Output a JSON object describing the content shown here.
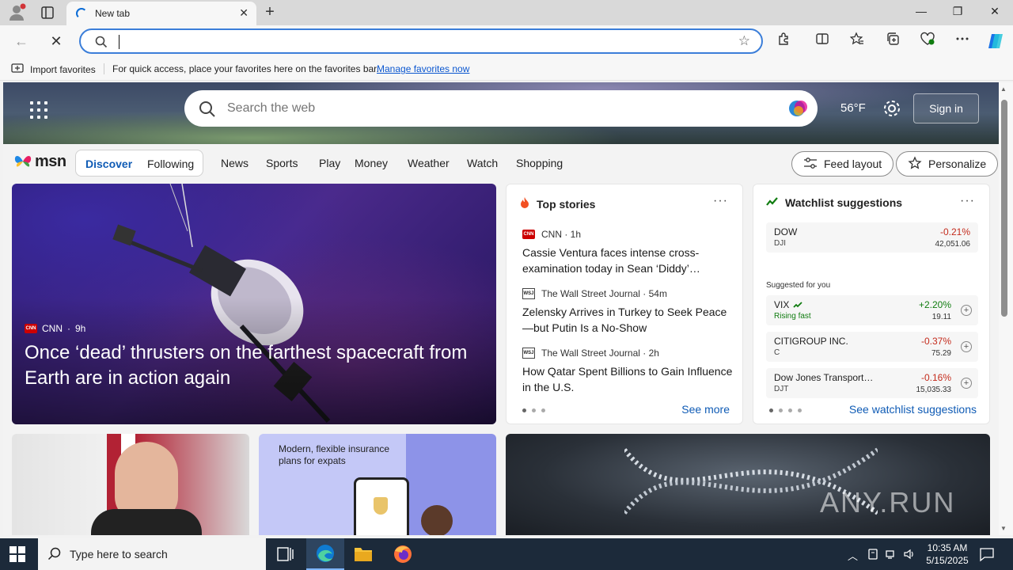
{
  "window": {
    "tab_title": "New tab",
    "tab_close": "✕",
    "new_tab": "+",
    "minimize": "—",
    "restore": "❐",
    "close": "✕"
  },
  "addressbar": {
    "back": "←",
    "stop": "✕",
    "url_value": "",
    "favorite_star": "☆",
    "tools": [
      "extensions-icon",
      "split-screen-icon",
      "favorites-icon",
      "collections-icon",
      "browser-essentials-icon",
      "more-icon",
      "copilot-icon"
    ]
  },
  "favorites_bar": {
    "import_label": "Import favorites",
    "message": "For quick access, place your favorites here on the favorites bar.",
    "manage_link": "Manage favorites now"
  },
  "hero": {
    "search_placeholder": "Search the web",
    "temperature": "56°F",
    "signin_label": "Sign in"
  },
  "msn_nav": {
    "logo_text": "msn",
    "discover": "Discover",
    "following": "Following",
    "links": [
      "News",
      "Sports",
      "Play",
      "Money",
      "Weather",
      "Watch",
      "Shopping"
    ],
    "feed_layout": "Feed layout",
    "personalize": "Personalize"
  },
  "hero_card": {
    "source": "CNN",
    "age": "9h",
    "headline": "Once ‘dead’ thrusters on the farthest spacecraft from Earth are in action again"
  },
  "top_stories": {
    "title": "Top stories",
    "more": "···",
    "stories": [
      {
        "source": "CNN · 1h",
        "title": "Cassie Ventura faces intense cross-examination today in Sean ‘Diddy’…"
      },
      {
        "source": "The Wall Street Journal · 54m",
        "title": "Zelensky Arrives in Turkey to Seek Peace—but Putin Is a No-Show"
      },
      {
        "source": "The Wall Street Journal · 2h",
        "title": "How Qatar Spent Billions to Gain Influence in the U.S."
      }
    ],
    "see_more": "See more"
  },
  "watchlist": {
    "title": "Watchlist suggestions",
    "more": "···",
    "suggested_label": "Suggested for you",
    "main": {
      "name": "DOW",
      "symbol": "DJI",
      "change": "-0.21%",
      "price": "42,051.06"
    },
    "items": [
      {
        "name": "VIX",
        "symbol": "Rising fast",
        "change": "+2.20%",
        "price": "19.11"
      },
      {
        "name": "CITIGROUP INC.",
        "symbol": "C",
        "change": "-0.37%",
        "price": "75.29"
      },
      {
        "name": "Dow Jones Transport…",
        "symbol": "DJT",
        "change": "-0.16%",
        "price": "15,035.33"
      }
    ],
    "see_link": "See watchlist suggestions"
  },
  "tiles": {
    "insurance_copy": "Modern, flexible insurance plans for expats",
    "watermark": "ANY.RUN"
  },
  "taskbar": {
    "search_placeholder": "Type here to search",
    "time": "10:35 AM",
    "date": "5/15/2025"
  }
}
